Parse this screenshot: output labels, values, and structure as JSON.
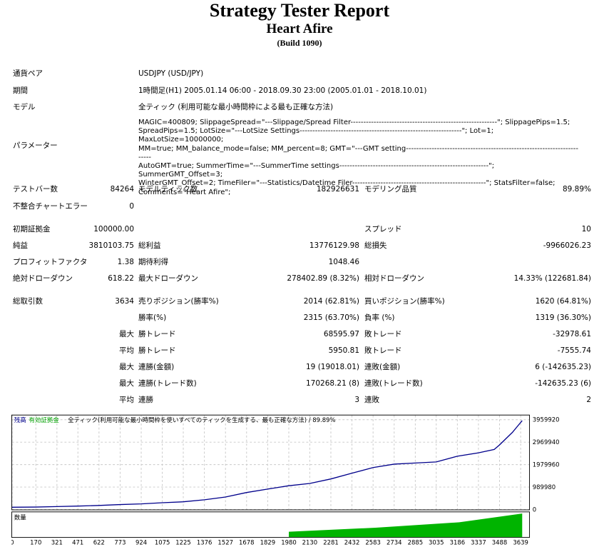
{
  "report": {
    "title": "Strategy Tester Report",
    "subtitle": "Heart Afire",
    "build": "(Build 1090)"
  },
  "info": {
    "symbol_label": "通貨ペア",
    "symbol_value": "USDJPY (USD/JPY)",
    "period_label": "期間",
    "period_value": "1時間足(H1) 2005.01.14 06:00 - 2018.09.30 23:00 (2005.01.01 - 2018.10.01)",
    "model_label": "モデル",
    "model_value": "全ティック (利用可能な最小時間枠による最も正確な方法)",
    "params_label": "パラメーター",
    "params_value": "MAGIC=400809; SlippageSpread=\"---Slippage/Spread Filter---------------------------------------------------------\"; SlippagePips=1.5;\nSpreadPips=1.5; LotSize=\"---LotSize Settings---------------------------------------------------------------\"; Lot=1; MaxLotSize=10000000;\nMM=true; MM_balance_mode=false; MM_percent=8; GMT=\"---GMT setting------------------------------------------------------------------------\nAutoGMT=true; SummerTime=\"---SummerTime settings----------------------------------------------------------\"; SummerGMT_Offset=3;\nWinterGMT_Offset=2; TimeFiler=\"---Statistics/Datetime Filer----------------------------------------------------\"; StatsFilter=false;\nComments=\"Heart Afire\";"
  },
  "stats": {
    "bars_label": "テストバー数",
    "bars_value": "84264",
    "ticks_label": "モデルティック数",
    "ticks_value": "182926631",
    "quality_label": "モデリング品質",
    "quality_value": "89.89%",
    "mismatch_label": "不整合チャートエラー",
    "mismatch_value": "0",
    "deposit_label": "初期証拠金",
    "deposit_value": "100000.00",
    "spread_label": "スプレッド",
    "spread_value": "10",
    "netprofit_label": "純益",
    "netprofit_value": "3810103.75",
    "grossprofit_label": "総利益",
    "grossprofit_value": "13776129.98",
    "grossloss_label": "総損失",
    "grossloss_value": "-9966026.23",
    "pf_label": "プロフィットファクタ",
    "pf_value": "1.38",
    "payoff_label": "期待利得",
    "payoff_value": "1048.46",
    "absdd_label": "絶対ドローダウン",
    "absdd_value": "618.22",
    "maxdd_label": "最大ドローダウン",
    "maxdd_value": "278402.89 (8.32%)",
    "reldd_label": "相対ドローダウン",
    "reldd_value": "14.33% (122681.84)",
    "trades_label": "総取引数",
    "trades_value": "3634",
    "short_label": "売りポジション(勝率%)",
    "short_value": "2014 (62.81%)",
    "long_label": "買いポジション(勝率%)",
    "long_value": "1620 (64.81%)",
    "win_label": "勝率(%)",
    "win_value": "2315 (63.70%)",
    "loss_label": "負率 (%)",
    "loss_value": "1319 (36.30%)",
    "max_label": "最大",
    "avg_label": "平均",
    "maxwin_label": "勝トレード",
    "maxwin_value": "68595.97",
    "maxloss_label": "敗トレード",
    "maxloss_value": "-32978.61",
    "avgwin_label": "勝トレード",
    "avgwin_value": "5950.81",
    "avgloss_label": "敗トレード",
    "avgloss_value": "-7555.74",
    "conswin_label": "連勝(金額)",
    "conswin_value": "19 (19018.01)",
    "consloss_label": "連敗(金額)",
    "consloss_value": "6 (-142635.23)",
    "consprofit_label": "連勝(トレード数)",
    "consprofit_value": "170268.21 (8)",
    "conslossamt_label": "連敗(トレード数)",
    "conslossamt_value": "-142635.23 (6)",
    "avgcw_label": "連勝",
    "avgcw_value": "3",
    "avgcl_label": "連敗",
    "avgcl_value": "2"
  },
  "chart_data": {
    "type": "line",
    "legend_balance": "残高",
    "legend_equity": "有効証拠金",
    "legend_rest": "全ティック(利用可能な最小時間枠を使いすべてのティックを生成する、最も正確な方法) / 89.89%",
    "volume_label": "数量",
    "y_ticks": [
      3959920,
      2969940,
      1979960,
      989980,
      0
    ],
    "ylim": [
      0,
      4150000
    ],
    "x_ticks": [
      0,
      170,
      321,
      471,
      622,
      773,
      924,
      1075,
      1225,
      1376,
      1527,
      1678,
      1829,
      1980,
      2130,
      2281,
      2432,
      2583,
      2734,
      2885,
      3035,
      3186,
      3337,
      3488,
      3639
    ],
    "xlim": [
      0,
      3700
    ],
    "balance_series": {
      "x": [
        0,
        170,
        321,
        471,
        622,
        773,
        924,
        1075,
        1225,
        1376,
        1527,
        1678,
        1829,
        1980,
        2130,
        2281,
        2432,
        2583,
        2734,
        2885,
        3035,
        3186,
        3337,
        3450,
        3488,
        3530,
        3580,
        3620,
        3650
      ],
      "y": [
        100000,
        110000,
        130000,
        150000,
        180000,
        220000,
        250000,
        300000,
        340000,
        430000,
        550000,
        750000,
        900000,
        1050000,
        1150000,
        1350000,
        1600000,
        1850000,
        2000000,
        2050000,
        2100000,
        2350000,
        2500000,
        2650000,
        2850000,
        3100000,
        3400000,
        3700000,
        3920000
      ]
    },
    "colors": {
      "balance": "#00008b",
      "volume": "#00b400",
      "grid": "#c8c8c8"
    }
  }
}
